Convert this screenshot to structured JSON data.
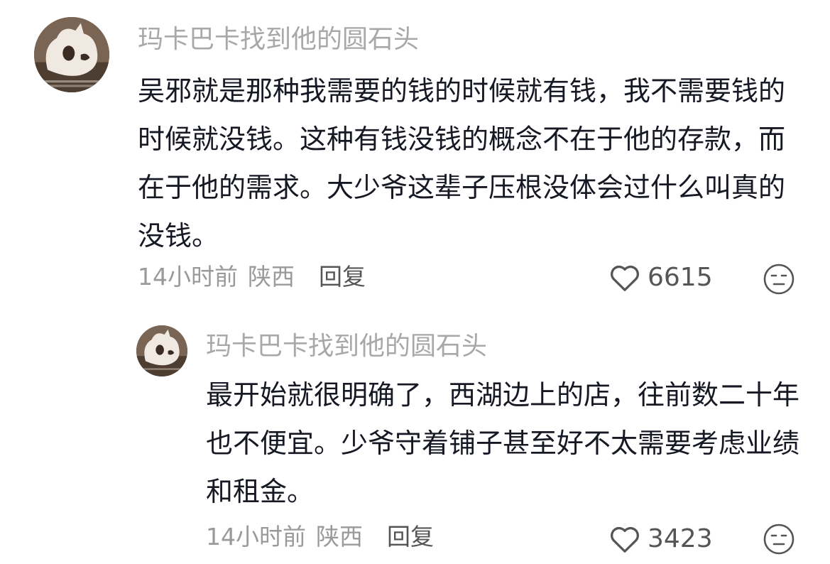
{
  "comments": [
    {
      "username": "玛卡巴卡找到他的圆石头",
      "text": "吴邪就是那种我需要的钱的时候就有钱，我不需要钱的时候就没钱。这种有钱没钱的概念不在于他的存款，而在于他的需求。大少爷这辈子压根没体会过什么叫真的没钱。",
      "time": "14小时前",
      "region": "陕西",
      "reply_label": "回复",
      "like_count": "6615",
      "avatar_icon": "cubone-skull-avatar",
      "reaction_icon": "expressionless-face-icon"
    },
    {
      "username": "玛卡巴卡找到他的圆石头",
      "text": "最开始就很明确了，西湖边上的店，往前数二十年也不便宜。少爷守着铺子甚至好不太需要考虑业绩和租金。",
      "time": "14小时前",
      "region": "陕西",
      "reply_label": "回复",
      "like_count": "3423",
      "avatar_icon": "cubone-skull-avatar",
      "reaction_icon": "expressionless-face-icon"
    }
  ],
  "colors": {
    "username": "#a8a8a8",
    "text": "#161823",
    "meta": "#9a9a9a",
    "action": "#555555"
  }
}
